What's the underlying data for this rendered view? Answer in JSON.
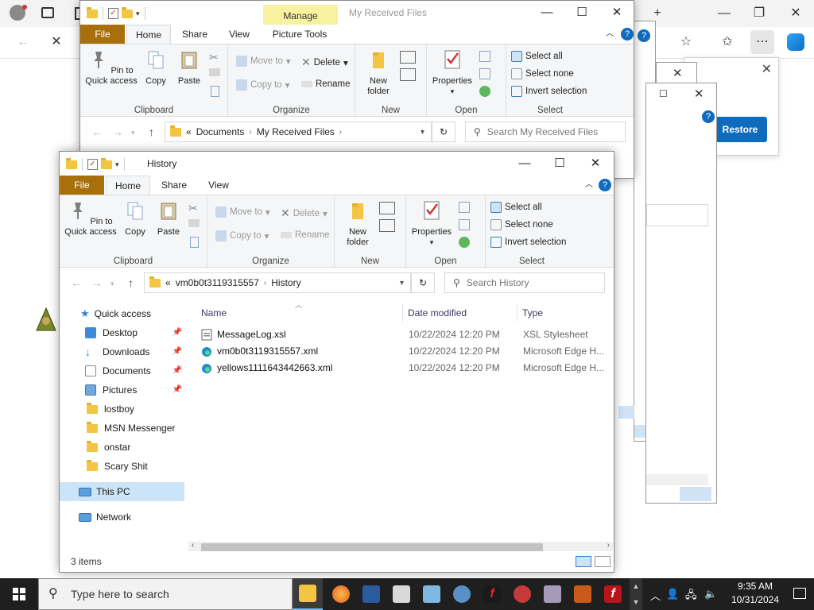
{
  "explorer_back": {
    "title": "My Received Files",
    "tabs": {
      "file": "File",
      "home": "Home",
      "share": "Share",
      "view": "View",
      "picture_tools": "Picture Tools",
      "manage": "Manage"
    },
    "ribbon": {
      "pin": "Pin to Quick access",
      "copy": "Copy",
      "paste": "Paste",
      "move_to": "Move to",
      "copy_to": "Copy to",
      "delete": "Delete",
      "rename": "Rename",
      "new_folder": "New folder",
      "properties": "Properties",
      "select_all": "Select all",
      "select_none": "Select none",
      "invert_selection": "Invert selection",
      "groups": {
        "clipboard": "Clipboard",
        "organize": "Organize",
        "new": "New",
        "open": "Open",
        "select": "Select"
      }
    },
    "address": {
      "prefix": "«",
      "crumbs": [
        "Documents",
        "My Received Files"
      ]
    },
    "search_placeholder": "Search My Received Files"
  },
  "explorer_front": {
    "title": "History",
    "tabs": {
      "file": "File",
      "home": "Home",
      "share": "Share",
      "view": "View"
    },
    "ribbon": {
      "pin": "Pin to Quick access",
      "copy": "Copy",
      "paste": "Paste",
      "move_to": "Move to",
      "copy_to": "Copy to",
      "delete": "Delete",
      "rename": "Rename",
      "new_folder": "New folder",
      "properties": "Properties",
      "select_all": "Select all",
      "select_none": "Select none",
      "invert_selection": "Invert selection",
      "groups": {
        "clipboard": "Clipboard",
        "organize": "Organize",
        "new": "New",
        "open": "Open",
        "select": "Select"
      }
    },
    "address": {
      "prefix": "«",
      "crumbs": [
        "vm0b0t3119315557",
        "History"
      ]
    },
    "search_placeholder": "Search History",
    "nav": {
      "quick_access": "Quick access",
      "items": [
        {
          "label": "Desktop",
          "pinned": true
        },
        {
          "label": "Downloads",
          "pinned": true
        },
        {
          "label": "Documents",
          "pinned": true
        },
        {
          "label": "Pictures",
          "pinned": true
        },
        {
          "label": "lostboy",
          "pinned": false
        },
        {
          "label": "MSN Messenger",
          "pinned": false
        },
        {
          "label": "onstar",
          "pinned": false
        },
        {
          "label": "Scary Shit",
          "pinned": false
        }
      ],
      "this_pc": "This PC",
      "network": "Network"
    },
    "columns": {
      "name": "Name",
      "date": "Date modified",
      "type": "Type"
    },
    "files": [
      {
        "name": "MessageLog.xsl",
        "date": "10/22/2024 12:20 PM",
        "type": "XSL Stylesheet",
        "icon": "xsl-file-icon"
      },
      {
        "name": "vm0b0t3119315557.xml",
        "date": "10/22/2024 12:20 PM",
        "type": "Microsoft Edge H...",
        "icon": "edge-file-icon"
      },
      {
        "name": "yellows1111643442663.xml",
        "date": "10/22/2024 12:20 PM",
        "type": "Microsoft Edge H...",
        "icon": "edge-file-icon"
      }
    ],
    "status": "3 items"
  },
  "edge": {
    "restore_label": "Restore"
  },
  "taskbar": {
    "search_placeholder": "Type here to search",
    "time": "9:35 AM",
    "date": "10/31/2024"
  },
  "colors": {
    "file_tab": "#a8700d",
    "manage_tab": "#f8f1a0",
    "accent": "#0f6cbd",
    "selection": "#cce4f7",
    "taskbar": "#1f1f1f"
  }
}
